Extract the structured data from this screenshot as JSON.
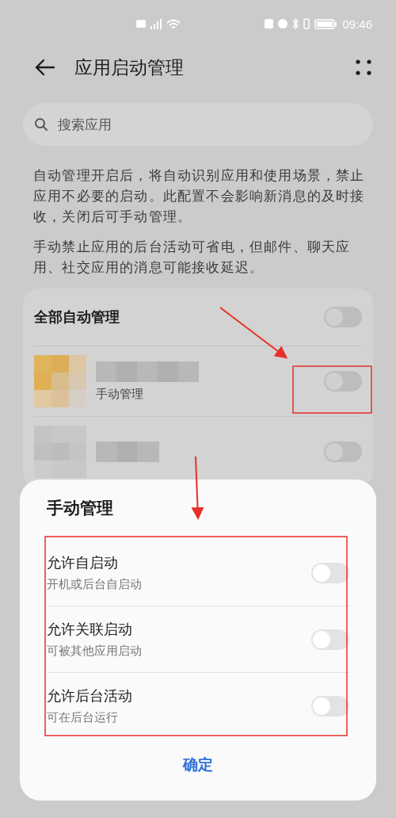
{
  "status_bar": {
    "time": "09:46"
  },
  "header": {
    "title": "应用启动管理"
  },
  "search": {
    "placeholder": "搜索应用"
  },
  "descriptions": [
    "自动管理开启后，将自动识别应用和使用场景，禁止应用不必要的启动。此配置不会影响新消息的及时接收，关闭后可手动管理。",
    "手动禁止应用的后台活动可省电，但邮件、聊天应用、社交应用的消息可能接收延迟。"
  ],
  "all_auto": {
    "label": "全部自动管理",
    "on": false
  },
  "apps": [
    {
      "subtitle": "手动管理",
      "on": false
    },
    {
      "on": false
    }
  ],
  "sheet": {
    "title": "手动管理",
    "options": [
      {
        "label": "允许自启动",
        "description": "开机或后台自启动",
        "on": false
      },
      {
        "label": "允许关联启动",
        "description": "可被其他应用启动",
        "on": false
      },
      {
        "label": "允许后台活动",
        "description": "可在后台运行",
        "on": false
      }
    ],
    "confirm": "确定"
  }
}
